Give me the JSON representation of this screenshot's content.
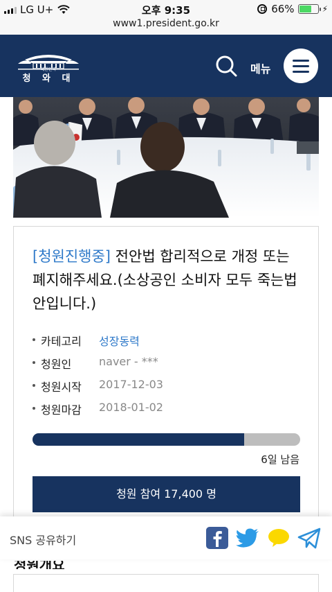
{
  "status_bar": {
    "carrier": "LG U+",
    "time": "오후 9:35",
    "battery": "66%",
    "battery_level": 0.66
  },
  "browser": {
    "url": "www1.president.go.kr"
  },
  "header": {
    "logo_small": "대한민국",
    "logo_text": "청 와 대",
    "menu_label": "메뉴",
    "icons": {
      "search": "search-icon",
      "menu": "hamburger-icon"
    }
  },
  "petition": {
    "status": "[청원진행중]",
    "title": " 전안법 합리적으로 개정 또는 폐지해주세요.(소상공인 소비자 모두 죽는법안입니다.)",
    "category_label": "카테고리",
    "category_value": "성장동력",
    "petitioner_label": "청원인",
    "petitioner_value": "naver - ***",
    "start_label": "청원시작",
    "start_value": "2017-12-03",
    "end_label": "청원마감",
    "end_value": "2018-01-02",
    "progress": 0.79,
    "days_left": "6일 남음",
    "join_button": "청원 참여 17,400 명",
    "colors": {
      "navy": "#17335f",
      "link_blue": "#2e79c9"
    }
  },
  "sns": {
    "label": "SNS 공유하기",
    "icons": [
      "facebook-icon",
      "twitter-icon",
      "kakaotalk-icon",
      "telegram-icon"
    ]
  }
}
